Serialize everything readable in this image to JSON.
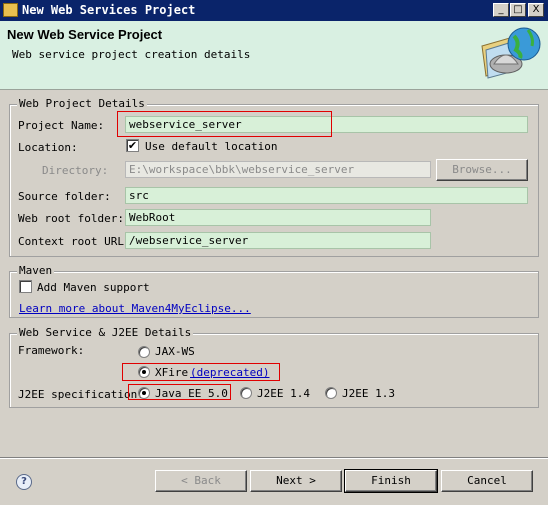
{
  "window": {
    "title": "New Web Services Project",
    "controls": {
      "minimize": "_",
      "maximize": "□",
      "close": "X"
    }
  },
  "header": {
    "title": "New Web Service Project",
    "description": "Web service project creation details"
  },
  "web_project_details": {
    "legend": "Web Project Details",
    "project_name": {
      "label": "Project Name:",
      "value": "webservice_server"
    },
    "location": {
      "label": "Location:",
      "checkbox_label": "Use default location",
      "checked": true
    },
    "directory": {
      "label": "Directory:",
      "value": "E:\\workspace\\bbk\\webservice_server",
      "browse_label": "Browse..."
    },
    "source_folder": {
      "label": "Source folder:",
      "value": "src"
    },
    "web_root_folder": {
      "label": "Web root folder:",
      "value": "WebRoot"
    },
    "context_root_url": {
      "label": "Context root URL:",
      "value": "/webservice_server"
    }
  },
  "maven": {
    "legend": "Maven",
    "add_support_label": "Add Maven support",
    "learn_more_link": "Learn more about Maven4MyEclipse..."
  },
  "ws_j2ee": {
    "legend": "Web Service & J2EE Details",
    "framework_label": "Framework:",
    "framework_options": [
      {
        "label": "JAX-WS",
        "selected": false
      },
      {
        "label": "XFire",
        "suffix": "(deprecated)",
        "selected": true
      }
    ],
    "j2ee_label": "J2EE specification:",
    "j2ee_options": [
      {
        "label": "Java EE 5.0",
        "selected": true
      },
      {
        "label": "J2EE 1.4",
        "selected": false
      },
      {
        "label": "J2EE 1.3",
        "selected": false
      }
    ]
  },
  "footer": {
    "help_icon_text": "?",
    "back_label": "< Back",
    "next_label": "Next >",
    "finish_label": "Finish",
    "cancel_label": "Cancel"
  },
  "colors": {
    "titlebar": "#0a246a",
    "header_bg": "#d9f0e2",
    "field_bg": "#d8f0d8",
    "highlight_box": "#e00000",
    "link": "#0000c0"
  }
}
